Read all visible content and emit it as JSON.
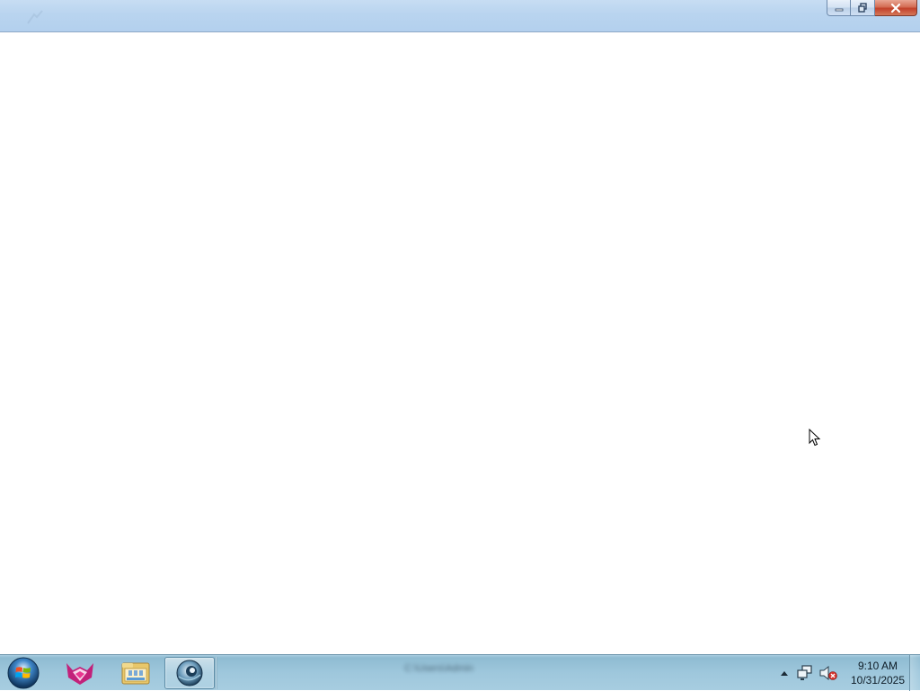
{
  "window": {
    "caption": {
      "minimize_icon": "minimize-icon",
      "restore_icon": "restore-icon",
      "close_icon": "close-icon"
    }
  },
  "taskbar": {
    "start_icon": "windows-orb-icon",
    "pinned": [
      {
        "name": "app-fox-icon"
      },
      {
        "name": "file-explorer-icon"
      },
      {
        "name": "browser-globe-icon",
        "active": true
      }
    ],
    "active_window_title": "C:\\Users\\Admin",
    "tray": {
      "network_icon": "network-icon",
      "volume_icon": "volume-muted-icon",
      "time": "9:10 AM",
      "date": "10/31/2025"
    }
  },
  "colors": {
    "titlebar": "#b9d4ef",
    "taskbar": "#9ec7dc",
    "close_button": "#c2412a"
  }
}
